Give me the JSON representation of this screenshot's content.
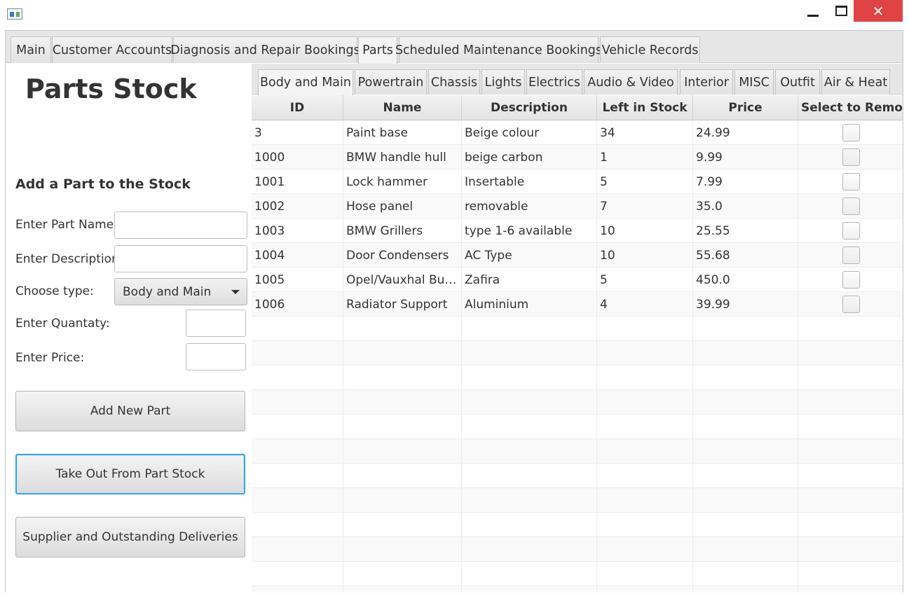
{
  "window": {
    "icons": {
      "app": "app-icon",
      "minimize": "minimize-icon",
      "maximize": "maximize-icon",
      "close": "close-icon"
    },
    "close_glyph": "✕"
  },
  "main_tabs": [
    {
      "label": "Main"
    },
    {
      "label": "Customer Accounts"
    },
    {
      "label": "Diagnosis and Repair Bookings"
    },
    {
      "label": "Parts",
      "selected": true
    },
    {
      "label": "Scheduled Maintenance Bookings"
    },
    {
      "label": "Vehicle Records"
    }
  ],
  "left_panel": {
    "title": "Parts Stock",
    "add_heading": "Add a Part to the Stock",
    "form": {
      "part_name_label": "Enter Part Name:",
      "part_name_value": "",
      "description_label": "Enter Description:",
      "description_value": "",
      "type_label": "Choose type:",
      "type_value": "Body and Main",
      "quantity_label": "Enter Quantaty:",
      "quantity_value": "",
      "price_label": "Enter Price:",
      "price_value": ""
    },
    "buttons": {
      "add_new_part": "Add New Part",
      "take_out": "Take Out From Part Stock",
      "supplier": "Supplier and Outstanding Deliveries"
    }
  },
  "sub_tabs": [
    {
      "label": "Body and Main",
      "selected": true
    },
    {
      "label": "Powertrain"
    },
    {
      "label": "Chassis"
    },
    {
      "label": "Lights"
    },
    {
      "label": "Electrics"
    },
    {
      "label": "Audio & Video"
    },
    {
      "label": "Interior"
    },
    {
      "label": "MISC"
    },
    {
      "label": "Outfit"
    },
    {
      "label": "Air & Heat"
    }
  ],
  "table": {
    "columns": [
      "ID",
      "Name",
      "Description",
      "Left in Stock",
      "Price",
      "Select to Remove"
    ],
    "rows": [
      {
        "id": "3",
        "name": "Paint base",
        "description": "Beige colour",
        "left": "34",
        "price": "24.99",
        "selected": false
      },
      {
        "id": "1000",
        "name": "BMW handle hull",
        "description": "beige carbon",
        "left": "1",
        "price": "9.99",
        "selected": false
      },
      {
        "id": "1001",
        "name": "Lock hammer",
        "description": "Insertable",
        "left": "5",
        "price": "7.99",
        "selected": false
      },
      {
        "id": "1002",
        "name": "Hose panel",
        "description": "removable",
        "left": "7",
        "price": "35.0",
        "selected": false
      },
      {
        "id": "1003",
        "name": "BMW Grillers",
        "description": "type 1-6 available",
        "left": "10",
        "price": "25.55",
        "selected": false
      },
      {
        "id": "1004",
        "name": "Door Condensers",
        "description": "AC Type",
        "left": "10",
        "price": "55.68",
        "selected": false
      },
      {
        "id": "1005",
        "name": "Opel/Vauxhal Bu…",
        "description": "Zafira",
        "left": "5",
        "price": "450.0",
        "selected": false
      },
      {
        "id": "1006",
        "name": "Radiator Support",
        "description": "Aluminium",
        "left": "4",
        "price": "39.99",
        "selected": false
      }
    ]
  }
}
